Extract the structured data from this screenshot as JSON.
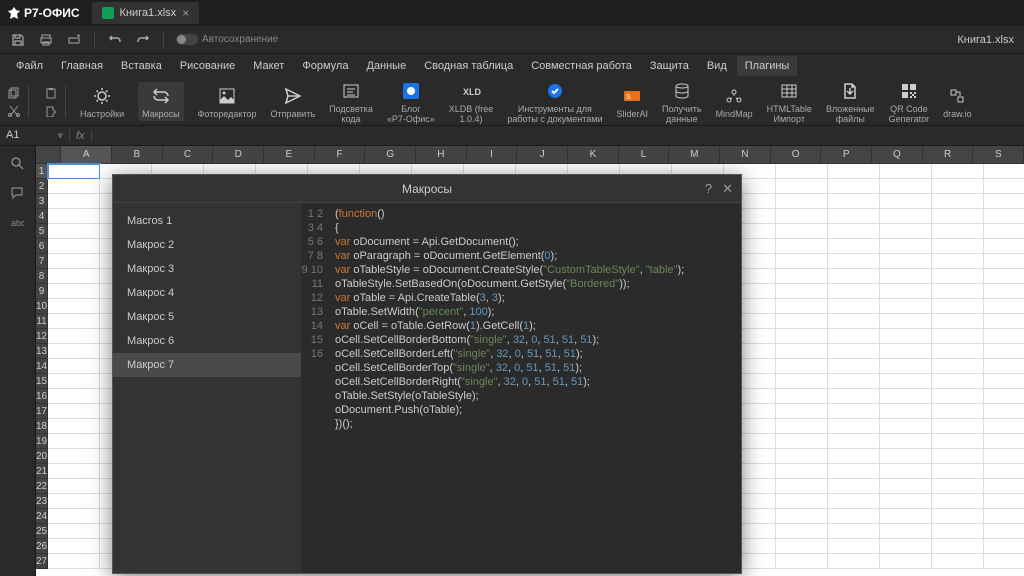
{
  "app": {
    "name": "Р7-ОФИС"
  },
  "tab": {
    "title": "Книга1.xlsx"
  },
  "filename": "Книга1.xlsx",
  "autosave": "Автосохранение",
  "menu": [
    "Файл",
    "Главная",
    "Вставка",
    "Рисование",
    "Макет",
    "Формула",
    "Данные",
    "Сводная таблица",
    "Совместная работа",
    "Защита",
    "Вид",
    "Плагины"
  ],
  "menu_active": 11,
  "ribbon": [
    {
      "label": "Настройки"
    },
    {
      "label": "Макросы",
      "active": true
    },
    {
      "label": "Фоторедактор"
    },
    {
      "label": "Отправить"
    },
    {
      "label": "Подсветка\nкода"
    },
    {
      "label": "Блог\n«Р7-Офис»"
    },
    {
      "label": "XLDB (free\n1.0.4)"
    },
    {
      "label": "Инструменты для\nработы с документами"
    },
    {
      "label": "SliderAI"
    },
    {
      "label": "Получить\nданные"
    },
    {
      "label": "MindMap"
    },
    {
      "label": "HTMLTable\nИмпорт"
    },
    {
      "label": "Вложенные\nфайлы"
    },
    {
      "label": "QR Code\nGenerator"
    },
    {
      "label": "draw.io"
    }
  ],
  "cellref": "A1",
  "columns": [
    "A",
    "B",
    "C",
    "D",
    "E",
    "F",
    "G",
    "H",
    "I",
    "J",
    "K",
    "L",
    "M",
    "N",
    "O",
    "P",
    "Q",
    "R",
    "S"
  ],
  "rows": [
    1,
    2,
    3,
    4,
    5,
    6,
    7,
    8,
    9,
    10,
    11,
    12,
    13,
    14,
    15,
    16,
    17,
    18,
    19,
    20,
    21,
    22,
    23,
    24,
    25,
    26,
    27
  ],
  "dialog": {
    "title": "Макросы",
    "macros": [
      "Macros 1",
      "Макрос 2",
      "Макрос 3",
      "Макрос 4",
      "Макрос 5",
      "Макрос 6",
      "Макрос 7"
    ],
    "selected": 6,
    "code_lines": [
      "1",
      "2",
      "3",
      "4",
      "5",
      "6",
      "7",
      "8",
      "9",
      "10",
      "11",
      "12",
      "13",
      "14",
      "15",
      "16"
    ],
    "code": [
      {
        "t": "(",
        "c": "pn"
      },
      {
        "t": "function",
        "c": "kw"
      },
      {
        "t": "()",
        "c": "pn"
      },
      {
        "t": "\n"
      },
      {
        "t": "{",
        "c": "pn"
      },
      {
        "t": "\n"
      },
      {
        "t": "var",
        "c": "kw"
      },
      {
        "t": " oDocument = Api.GetDocument();",
        "c": "pn"
      },
      {
        "t": "\n"
      },
      {
        "t": "var",
        "c": "kw"
      },
      {
        "t": " oParagraph = oDocument.GetElement(",
        "c": "pn"
      },
      {
        "t": "0",
        "c": "num"
      },
      {
        "t": ");",
        "c": "pn"
      },
      {
        "t": "\n"
      },
      {
        "t": "var",
        "c": "kw"
      },
      {
        "t": " oTableStyle = oDocument.CreateStyle(",
        "c": "pn"
      },
      {
        "t": "\"CustomTableStyle\"",
        "c": "str"
      },
      {
        "t": ", ",
        "c": "pn"
      },
      {
        "t": "\"table\"",
        "c": "str"
      },
      {
        "t": ");",
        "c": "pn"
      },
      {
        "t": "\n"
      },
      {
        "t": "oTableStyle.SetBasedOn(oDocument.GetStyle(",
        "c": "pn"
      },
      {
        "t": "\"Bordered\"",
        "c": "str"
      },
      {
        "t": "));",
        "c": "pn"
      },
      {
        "t": "\n"
      },
      {
        "t": "var",
        "c": "kw"
      },
      {
        "t": " oTable = Api.CreateTable(",
        "c": "pn"
      },
      {
        "t": "3",
        "c": "num"
      },
      {
        "t": ", ",
        "c": "pn"
      },
      {
        "t": "3",
        "c": "num"
      },
      {
        "t": ");",
        "c": "pn"
      },
      {
        "t": "\n"
      },
      {
        "t": "oTable.SetWidth(",
        "c": "pn"
      },
      {
        "t": "\"percent\"",
        "c": "str"
      },
      {
        "t": ", ",
        "c": "pn"
      },
      {
        "t": "100",
        "c": "num"
      },
      {
        "t": ");",
        "c": "pn"
      },
      {
        "t": "\n"
      },
      {
        "t": "var",
        "c": "kw"
      },
      {
        "t": " oCell = oTable.GetRow(",
        "c": "pn"
      },
      {
        "t": "1",
        "c": "num"
      },
      {
        "t": ").GetCell(",
        "c": "pn"
      },
      {
        "t": "1",
        "c": "num"
      },
      {
        "t": ");",
        "c": "pn"
      },
      {
        "t": "\n"
      },
      {
        "t": "oCell.SetCellBorderBottom(",
        "c": "pn"
      },
      {
        "t": "\"single\"",
        "c": "str"
      },
      {
        "t": ", ",
        "c": "pn"
      },
      {
        "t": "32",
        "c": "num"
      },
      {
        "t": ", ",
        "c": "pn"
      },
      {
        "t": "0",
        "c": "num"
      },
      {
        "t": ", ",
        "c": "pn"
      },
      {
        "t": "51",
        "c": "num"
      },
      {
        "t": ", ",
        "c": "pn"
      },
      {
        "t": "51",
        "c": "num"
      },
      {
        "t": ", ",
        "c": "pn"
      },
      {
        "t": "51",
        "c": "num"
      },
      {
        "t": ");",
        "c": "pn"
      },
      {
        "t": "\n"
      },
      {
        "t": "oCell.SetCellBorderLeft(",
        "c": "pn"
      },
      {
        "t": "\"single\"",
        "c": "str"
      },
      {
        "t": ", ",
        "c": "pn"
      },
      {
        "t": "32",
        "c": "num"
      },
      {
        "t": ", ",
        "c": "pn"
      },
      {
        "t": "0",
        "c": "num"
      },
      {
        "t": ", ",
        "c": "pn"
      },
      {
        "t": "51",
        "c": "num"
      },
      {
        "t": ", ",
        "c": "pn"
      },
      {
        "t": "51",
        "c": "num"
      },
      {
        "t": ", ",
        "c": "pn"
      },
      {
        "t": "51",
        "c": "num"
      },
      {
        "t": ");",
        "c": "pn"
      },
      {
        "t": "\n"
      },
      {
        "t": "oCell.SetCellBorderTop(",
        "c": "pn"
      },
      {
        "t": "\"single\"",
        "c": "str"
      },
      {
        "t": ", ",
        "c": "pn"
      },
      {
        "t": "32",
        "c": "num"
      },
      {
        "t": ", ",
        "c": "pn"
      },
      {
        "t": "0",
        "c": "num"
      },
      {
        "t": ", ",
        "c": "pn"
      },
      {
        "t": "51",
        "c": "num"
      },
      {
        "t": ", ",
        "c": "pn"
      },
      {
        "t": "51",
        "c": "num"
      },
      {
        "t": ", ",
        "c": "pn"
      },
      {
        "t": "51",
        "c": "num"
      },
      {
        "t": ");",
        "c": "pn"
      },
      {
        "t": "\n"
      },
      {
        "t": "oCell.SetCellBorderRight(",
        "c": "pn"
      },
      {
        "t": "\"single\"",
        "c": "str"
      },
      {
        "t": ", ",
        "c": "pn"
      },
      {
        "t": "32",
        "c": "num"
      },
      {
        "t": ", ",
        "c": "pn"
      },
      {
        "t": "0",
        "c": "num"
      },
      {
        "t": ", ",
        "c": "pn"
      },
      {
        "t": "51",
        "c": "num"
      },
      {
        "t": ", ",
        "c": "pn"
      },
      {
        "t": "51",
        "c": "num"
      },
      {
        "t": ", ",
        "c": "pn"
      },
      {
        "t": "51",
        "c": "num"
      },
      {
        "t": ");",
        "c": "pn"
      },
      {
        "t": "\n"
      },
      {
        "t": "oTable.SetStyle(oTableStyle);",
        "c": "pn"
      },
      {
        "t": "\n"
      },
      {
        "t": "oDocument.Push(oTable);",
        "c": "pn"
      },
      {
        "t": "\n"
      },
      {
        "t": "})();",
        "c": "pn"
      }
    ]
  }
}
